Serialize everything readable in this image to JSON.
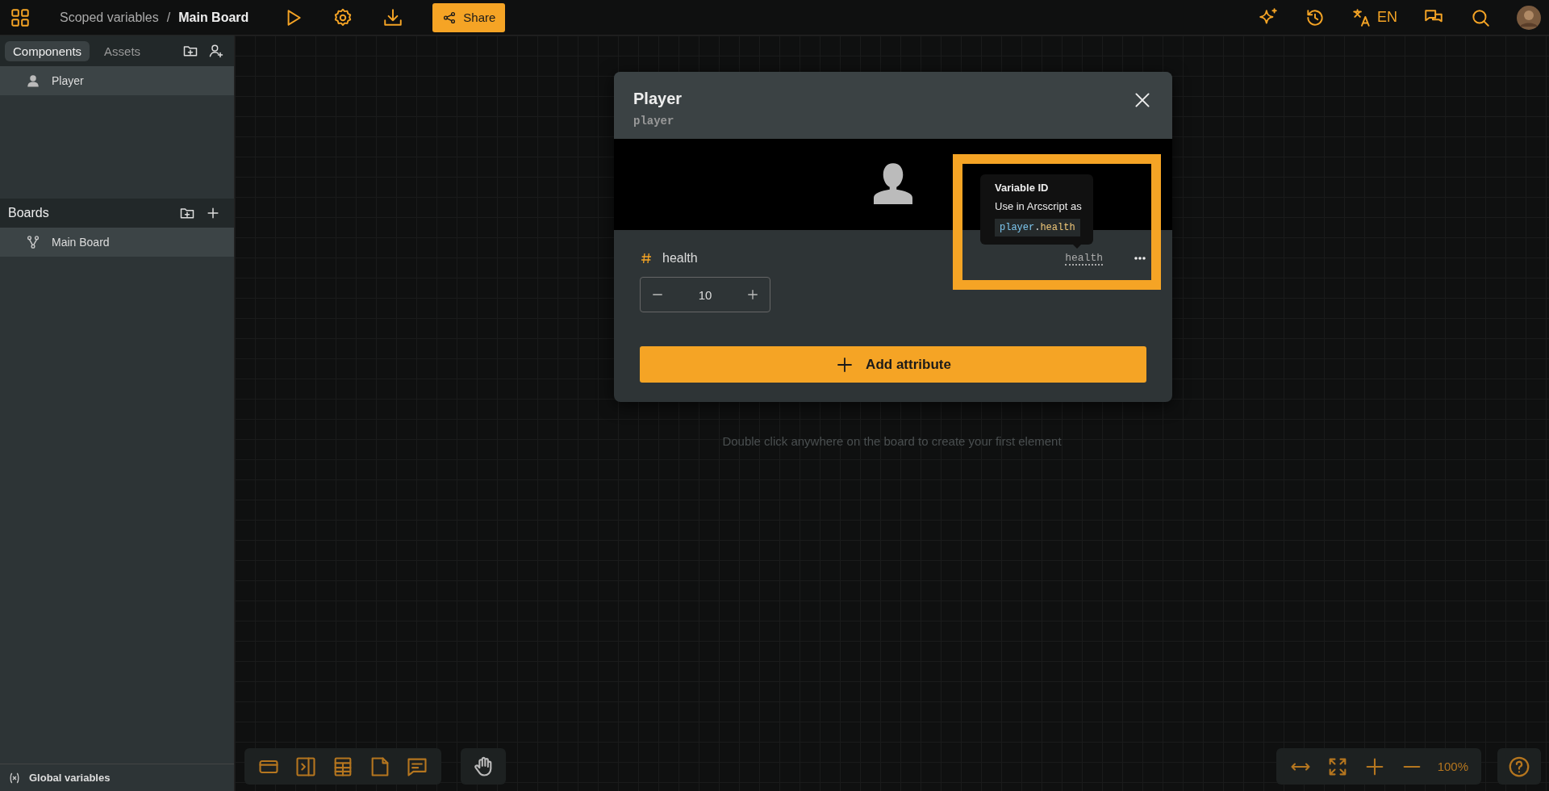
{
  "topbar": {
    "breadcrumb": [
      {
        "label": "Scoped variables",
        "current": false
      },
      {
        "label": "Main Board",
        "current": true
      }
    ],
    "separator": "/",
    "share_button": "Share",
    "language": "EN"
  },
  "sidebar": {
    "tabs": [
      {
        "label": "Components",
        "selected": true
      },
      {
        "label": "Assets",
        "selected": false
      }
    ],
    "components": [
      {
        "label": "Player",
        "selected": true
      }
    ],
    "boards_title": "Boards",
    "boards": [
      {
        "label": "Main Board",
        "selected": true
      }
    ],
    "footer": "Global variables"
  },
  "canvas": {
    "hint": "Double click anywhere on the board to create your first element",
    "zoom_level": "100%"
  },
  "modal": {
    "title": "Player",
    "id": "player",
    "attributes": [
      {
        "name": "health",
        "value": "10",
        "variable_id": "health"
      }
    ],
    "tooltip": {
      "title": "Variable ID",
      "text": "Use in Arcscript as",
      "code": [
        {
          "text": "player",
          "kind": "object"
        },
        {
          "text": ".",
          "kind": "punct"
        },
        {
          "text": "health",
          "kind": "property"
        }
      ]
    },
    "add_button": "Add attribute"
  }
}
